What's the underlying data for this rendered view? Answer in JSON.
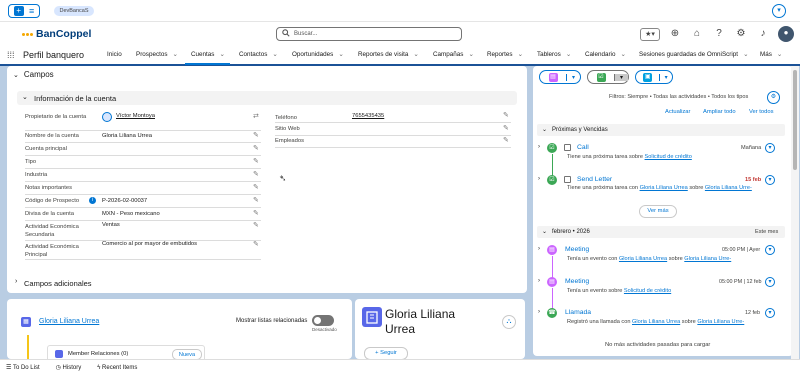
{
  "topbar": {
    "env": "DevBancaS"
  },
  "brand": {
    "name": "BanCoppel"
  },
  "search": {
    "placeholder": "Buscar..."
  },
  "nav": {
    "app_name": "Perfil banquero",
    "items": [
      "Inicio",
      "Prospectos",
      "Cuentas",
      "Contactos",
      "Oportunidades",
      "Reportes de visita",
      "Campañas",
      "Reportes",
      "Tableros",
      "Calendario",
      "Sesiones guardadas de OmniScript",
      "Más"
    ]
  },
  "details": {
    "section_title": "Campos",
    "subsection_title": "Información de la cuenta",
    "left_fields": [
      {
        "label": "Propietario de la cuenta",
        "value": "Víctor Montoya"
      },
      {
        "label": "Nombre de la cuenta",
        "value": "Gloria Liliana Urrea"
      },
      {
        "label": "Cuenta principal",
        "value": ""
      },
      {
        "label": "Tipo",
        "value": ""
      },
      {
        "label": "Industria",
        "value": ""
      },
      {
        "label": "Notas importantes",
        "value": ""
      },
      {
        "label": "Código de Prospecto",
        "value": "P-2026-02-00037"
      },
      {
        "label": "Divisa de la cuenta",
        "value": "MXN - Peso mexicano"
      },
      {
        "label": "Actividad Económica Secundaria",
        "value": "Ventas"
      },
      {
        "label": "Actividad Económica Principal",
        "value": "Comercio al por mayor de embutidos"
      }
    ],
    "right_fields": [
      {
        "label": "Teléfono",
        "value": "7655435435"
      },
      {
        "label": "Sitio Web",
        "value": ""
      },
      {
        "label": "Empleados",
        "value": ""
      }
    ],
    "additional_title": "Campos adicionales"
  },
  "related": {
    "account_link": "Gloria Liliana Urrea",
    "toggle_label": "Mostrar listas relacionadas",
    "toggle_state": "Desactivado",
    "member_label": "Member Relaciones (0)",
    "new_button": "Nueva"
  },
  "account_card": {
    "name": "Gloria Liliana Urrea",
    "follow": "Seguir"
  },
  "activity": {
    "filters": "Filtros: Siempre • Todas las actividades • Todos los tipos",
    "refresh": "Actualizar",
    "expand_all": "Ampliar todo",
    "view_all": "Ver todos",
    "upcoming_title": "Próximas y Vencidas",
    "upcoming": [
      {
        "title": "Call",
        "sub_prefix": "Tiene una próxima tarea sobre",
        "link1": "Solicitud de crédito",
        "link2": "",
        "date": "Mañana",
        "overdue": false
      },
      {
        "title": "Send Letter",
        "sub_prefix": "Tiene una próxima tarea con",
        "link1": "Gloria Liliana Urrea",
        "link2": "Gloria Liliana Urre-",
        "date": "15 feb",
        "overdue": true
      }
    ],
    "view_more": "Ver más",
    "month_title": "febrero • 2026",
    "month_badge": "Este mes",
    "past": [
      {
        "title": "Meeting",
        "sub_prefix": "Tenía un evento con",
        "link1": "Gloria Liliana Urrea",
        "link2": "Gloria Liliana Urre-",
        "date": "05:00 PM | Ayer",
        "kind": "event"
      },
      {
        "title": "Meeting",
        "sub_prefix": "Tenía un evento sobre",
        "link1": "Solicitud de crédito",
        "link2": "",
        "date": "05:00 PM | 12 feb",
        "kind": "event"
      },
      {
        "title": "Llamada",
        "sub_prefix": "Registró una llamada con",
        "link1": "Gloria Liliana Urrea",
        "link2": "Gloria Liliana Urre-",
        "date": "12 feb",
        "kind": "call"
      }
    ],
    "no_more": "No más actividades pasadas para cargar",
    "sobre": "sobre"
  },
  "footer": {
    "items": [
      "To Do List",
      "History",
      "Recent Items"
    ]
  },
  "colors": {
    "accent": "#0176d3",
    "task": "#3ba755",
    "event": "#cb65ff",
    "email": "#00a1e0",
    "overdue": "#c23934",
    "nav_border": "#1b5297"
  }
}
